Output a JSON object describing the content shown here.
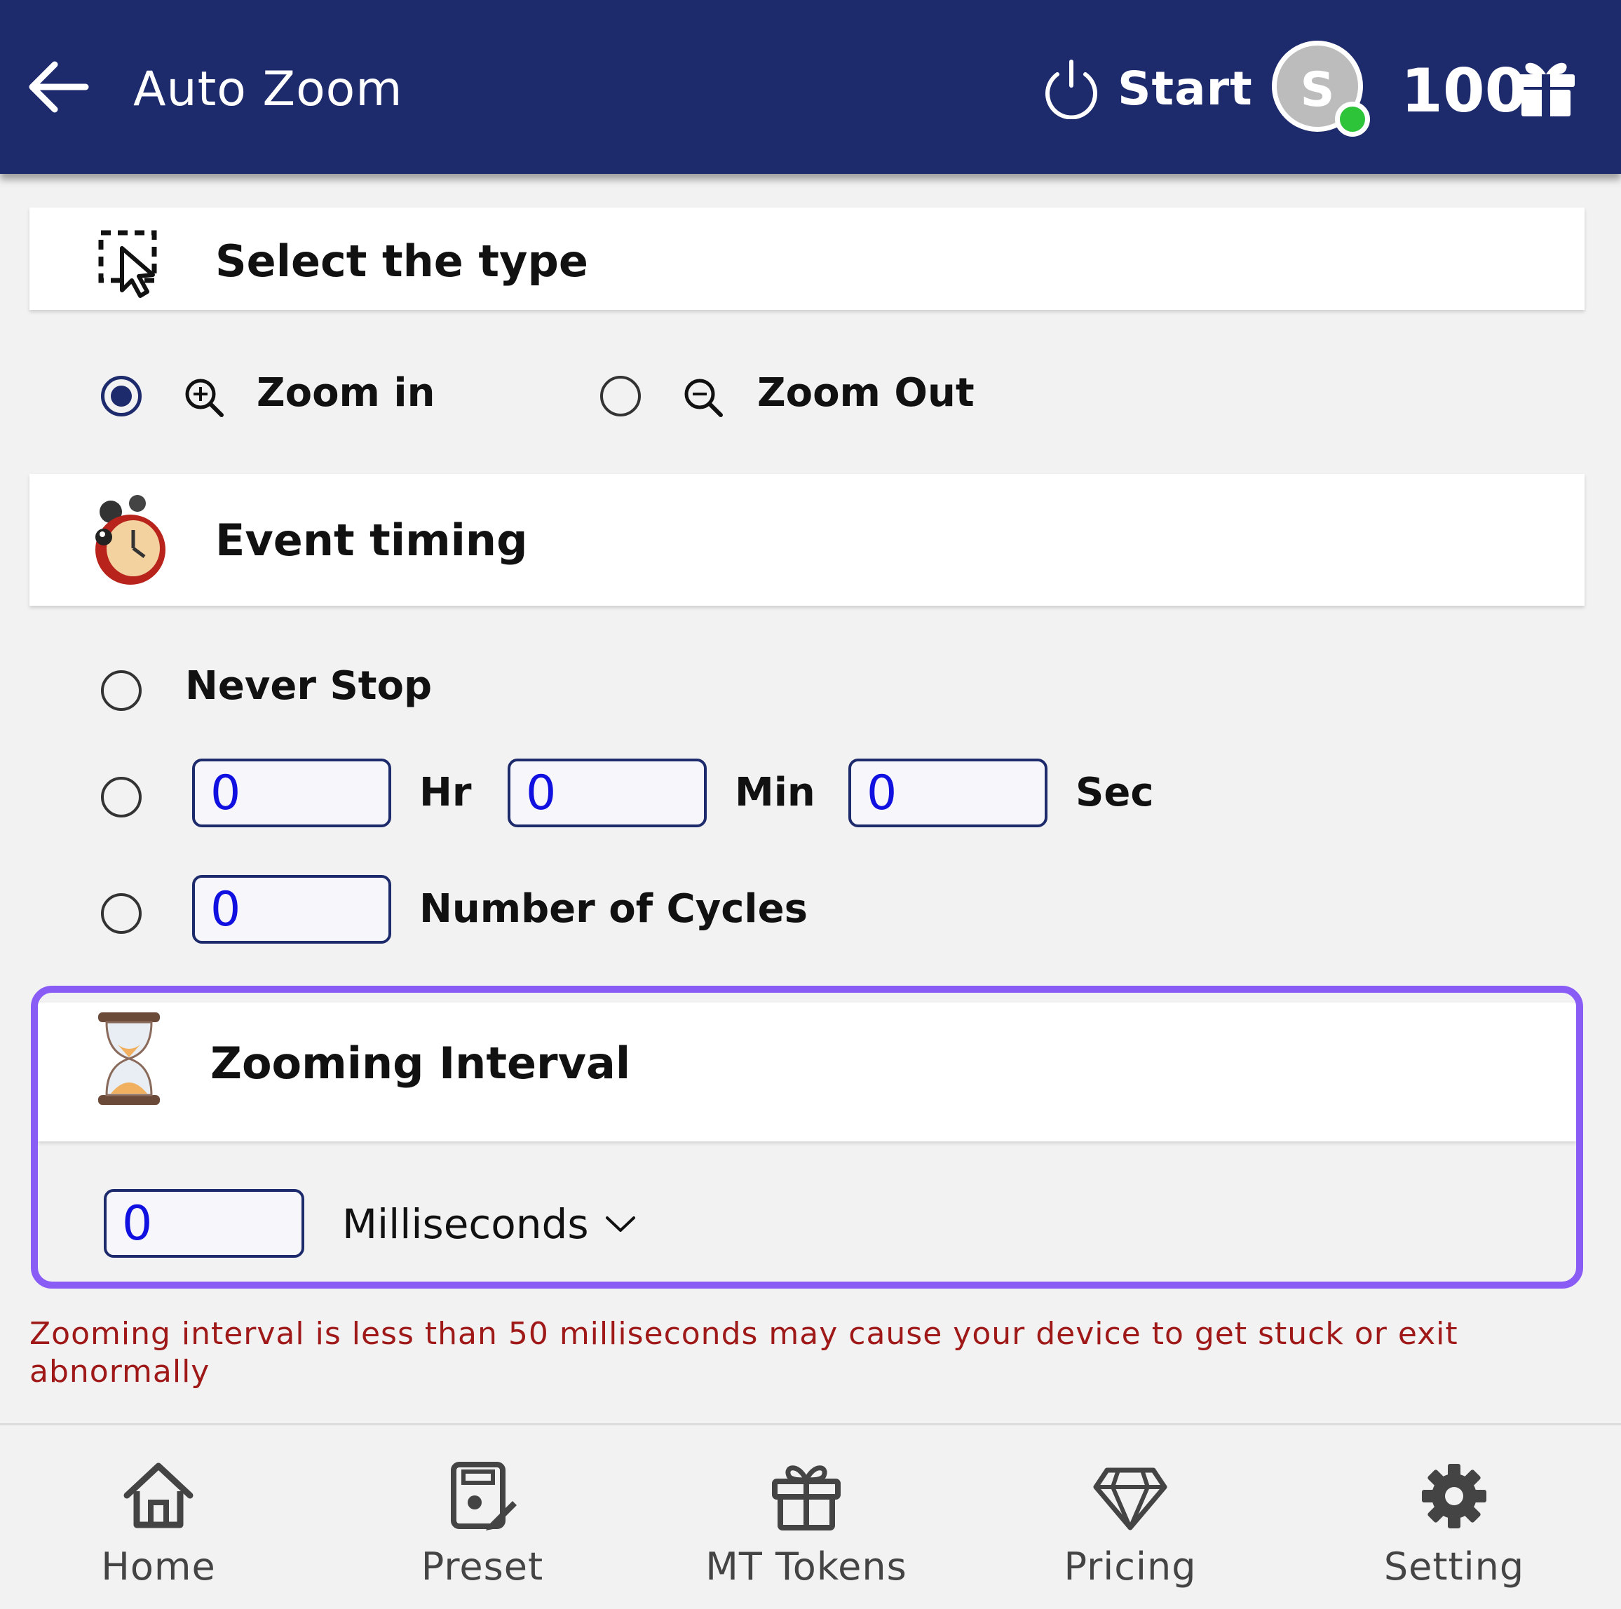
{
  "header": {
    "title": "Auto Zoom",
    "start_label": "Start",
    "avatar_letter": "S",
    "token_count": "100"
  },
  "type_section": {
    "title": "Select the type",
    "options": [
      {
        "label": "Zoom in",
        "selected": true
      },
      {
        "label": "Zoom Out",
        "selected": false
      }
    ]
  },
  "timing_section": {
    "title": "Event timing",
    "never_stop_label": "Never Stop",
    "hr_value": "0",
    "hr_label": "Hr",
    "min_value": "0",
    "min_label": "Min",
    "sec_value": "0",
    "sec_label": "Sec",
    "cycles_value": "0",
    "cycles_label": "Number of Cycles"
  },
  "interval_section": {
    "title": "Zooming Interval",
    "value": "0",
    "unit": "Milliseconds"
  },
  "warning": "Zooming interval is less than 50 milliseconds may cause your device to get stuck or exit abnormally",
  "bottom_nav": [
    {
      "label": "Home",
      "icon": "home-icon"
    },
    {
      "label": "Preset",
      "icon": "preset-icon"
    },
    {
      "label": "MT Tokens",
      "icon": "gift-icon"
    },
    {
      "label": "Pricing",
      "icon": "diamond-icon"
    },
    {
      "label": "Setting",
      "icon": "gear-icon"
    }
  ],
  "colors": {
    "header_bg": "#1d2a6b",
    "highlight_border": "#8a5cf6",
    "input_text": "#1010e0",
    "warning_text": "#a01919",
    "online_dot": "#2ec43a"
  }
}
